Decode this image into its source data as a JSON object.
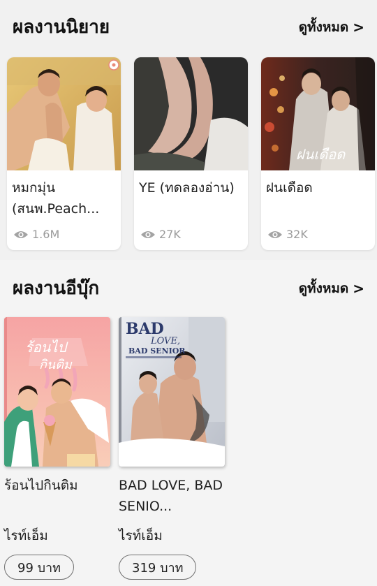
{
  "novels": {
    "title": "ผลงานนิยาย",
    "see_all": "ดูทั้งหมด",
    "items": [
      {
        "title": "หมกมุ่น (สนพ.Peach...",
        "views": "1.6M"
      },
      {
        "title": "YE (ทดลองอ่าน)",
        "views": "27K"
      },
      {
        "title": "ฝนเดือด",
        "views": "32K"
      }
    ]
  },
  "ebooks": {
    "title": "ผลงานอีบุ๊ก",
    "see_all": "ดูทั้งหมด",
    "items": [
      {
        "title": "ร้อนไปกินติม",
        "author": "ไรท์เอ็ม",
        "price": "99 บาท",
        "cover_text": "ร้อนไปกินติม"
      },
      {
        "title": "BAD LOVE, BAD SENIO...",
        "author": "ไรท์เอ็ม",
        "price": "319 บาท",
        "cover_text": [
          "BAD",
          "LOVE,",
          "BAD SENIOR"
        ]
      }
    ]
  },
  "icons": {
    "view": "eye-icon",
    "see_all": "chevron-right-icon"
  },
  "colors": {
    "muted": "#9b9b9b",
    "background": "#f1f1f1"
  }
}
